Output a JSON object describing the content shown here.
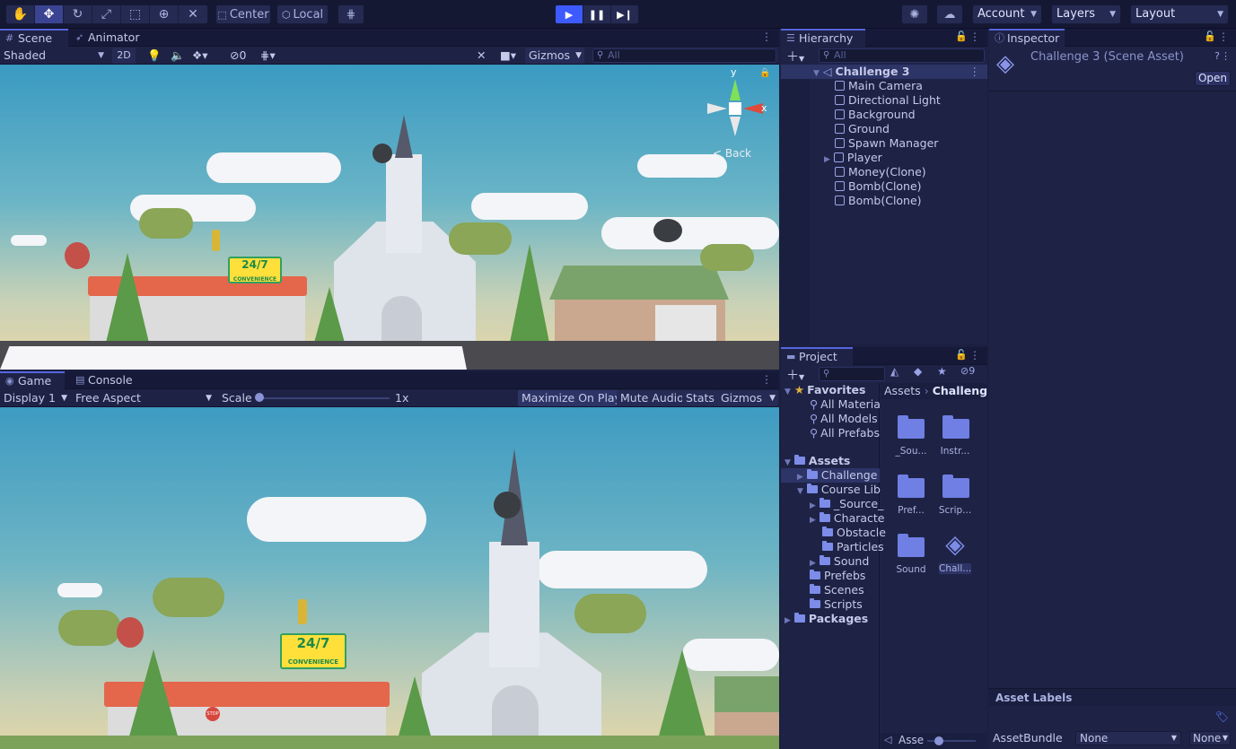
{
  "toolbar": {
    "tools": [
      "hand-tool",
      "move-tool",
      "rotate-tool",
      "scale-tool",
      "rect-tool",
      "transform-tool",
      "custom-tool"
    ],
    "pivot_label": "Center",
    "space_label": "Local",
    "account_label": "Account",
    "layers_label": "Layers",
    "layout_label": "Layout"
  },
  "scene_panel": {
    "tabs": [
      "Scene",
      "Animator"
    ],
    "shading_mode": "Shaded",
    "mode_2d": "2D",
    "hidden_count": "0",
    "gizmos_label": "Gizmos",
    "search_placeholder": "All",
    "back_label": "Back",
    "axis_y": "y",
    "axis_x": "x"
  },
  "game_panel": {
    "tabs": [
      "Game",
      "Console"
    ],
    "display": "Display 1",
    "aspect": "Free Aspect",
    "scale_label": "Scale",
    "scale_value": 0.0,
    "scale_text": "1x",
    "maximize_label": "Maximize On Play",
    "mute_label": "Mute Audio",
    "stats_label": "Stats",
    "gizmos_label": "Gizmos"
  },
  "hierarchy": {
    "title": "Hierarchy",
    "search_placeholder": "All",
    "scene_name": "Challenge 3",
    "items": [
      "Main Camera",
      "Directional Light",
      "Background",
      "Ground",
      "Spawn Manager",
      "Player",
      "Money(Clone)",
      "Bomb(Clone)",
      "Bomb(Clone)"
    ]
  },
  "inspector": {
    "title": "Inspector",
    "asset_title": "Challenge 3 (Scene Asset)",
    "open_label": "Open",
    "asset_labels_title": "Asset Labels",
    "assetbundle_label": "AssetBundle",
    "assetbundle_value": "None",
    "variant_value": "None"
  },
  "project": {
    "title": "Project",
    "hidden_count": "9",
    "favorites_label": "Favorites",
    "favorites": [
      "All Materia",
      "All Models",
      "All Prefabs"
    ],
    "assets_label": "Assets",
    "tree": [
      "Challenge",
      "Course Lib",
      "_Source_",
      "Characte",
      "Obstacle",
      "Particles",
      "Sound",
      "Prefebs",
      "Scenes",
      "Scripts"
    ],
    "packages_label": "Packages",
    "breadcrumb": [
      "Assets",
      "Challenge"
    ],
    "grid": [
      "_Sou...",
      "Instr...",
      "Pref...",
      "Scrip...",
      "Sound",
      "Chall..."
    ],
    "footer_label": "Asse"
  },
  "scene_view": {
    "store_sign": "24/7",
    "store_sub": "CONVENIENCE",
    "stop_sign": "STOP"
  }
}
